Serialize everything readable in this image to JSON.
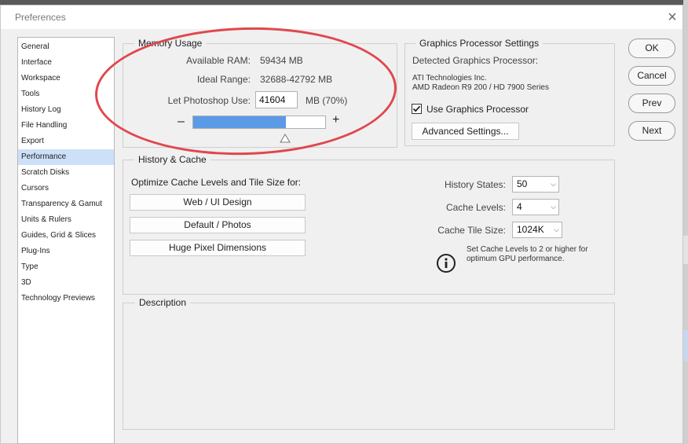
{
  "dialog": {
    "title": "Preferences",
    "close_glyph": "×"
  },
  "nav": {
    "items": [
      {
        "label": "General"
      },
      {
        "label": "Interface"
      },
      {
        "label": "Workspace"
      },
      {
        "label": "Tools"
      },
      {
        "label": "History Log"
      },
      {
        "label": "File Handling"
      },
      {
        "label": "Export"
      },
      {
        "label": "Performance",
        "selected": true
      },
      {
        "label": "Scratch Disks"
      },
      {
        "label": "Cursors"
      },
      {
        "label": "Transparency & Gamut"
      },
      {
        "label": "Units & Rulers"
      },
      {
        "label": "Guides, Grid & Slices"
      },
      {
        "label": "Plug-Ins"
      },
      {
        "label": "Type"
      },
      {
        "label": "3D"
      },
      {
        "label": "Technology Previews"
      }
    ]
  },
  "memory": {
    "legend": "Memory Usage",
    "available_label": "Available RAM:",
    "available_value": "59434 MB",
    "ideal_label": "Ideal Range:",
    "ideal_value": "32688-42792 MB",
    "use_label": "Let Photoshop Use:",
    "use_value": "41604",
    "use_unit": "MB (70%)",
    "minus": "–",
    "plus": "+",
    "usage_fraction": 0.7
  },
  "gpu": {
    "legend": "Graphics Processor Settings",
    "detected_label": "Detected Graphics Processor:",
    "vendor": "ATI Technologies Inc.",
    "model": "AMD Radeon R9 200 / HD 7900 Series",
    "use_gpu_label": "Use Graphics Processor",
    "use_gpu_checked": true,
    "advanced_button": "Advanced Settings..."
  },
  "history_cache": {
    "legend": "History & Cache",
    "optimize_label": "Optimize Cache Levels and Tile Size for:",
    "presets": [
      "Web / UI Design",
      "Default / Photos",
      "Huge Pixel Dimensions"
    ],
    "history_states_label": "History States:",
    "history_states_value": "50",
    "cache_levels_label": "Cache Levels:",
    "cache_levels_value": "4",
    "tile_size_label": "Cache Tile Size:",
    "tile_size_value": "1024K",
    "info_line1": "Set Cache Levels to 2 or higher for",
    "info_line2": "optimum GPU performance."
  },
  "description": {
    "legend": "Description"
  },
  "actions": {
    "ok": "OK",
    "cancel": "Cancel",
    "prev": "Prev",
    "next": "Next"
  },
  "colors": {
    "accent_fill": "#5b9ae6",
    "nav_selected": "#cce0f7",
    "annotation_circle": "#e0474c"
  },
  "chevron_glyph": "⌵"
}
